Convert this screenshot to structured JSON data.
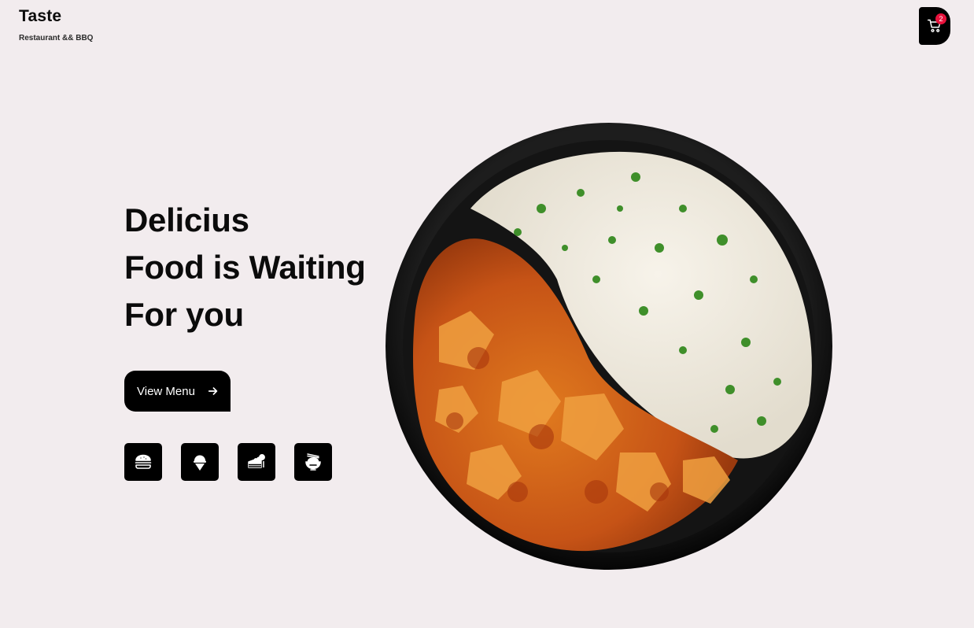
{
  "header": {
    "brand_title": "Taste",
    "brand_subtitle": "Restaurant && BBQ",
    "cart_count": "2",
    "cart_icon": "shopping-cart-icon"
  },
  "hero": {
    "title_lines": [
      "Delicius",
      "Food is Waiting",
      "For you"
    ],
    "cta_label": "View Menu",
    "cta_icon": "arrow-right-icon"
  },
  "categories": [
    {
      "icon": "burger-icon"
    },
    {
      "icon": "ice-cream-icon"
    },
    {
      "icon": "cake-slice-icon"
    },
    {
      "icon": "noodle-bowl-icon"
    }
  ],
  "dish_image": {
    "subject": "curry-with-rice-bowl"
  },
  "colors": {
    "background": "#f2ecee",
    "primary": "#000000",
    "badge": "#e8123c"
  }
}
